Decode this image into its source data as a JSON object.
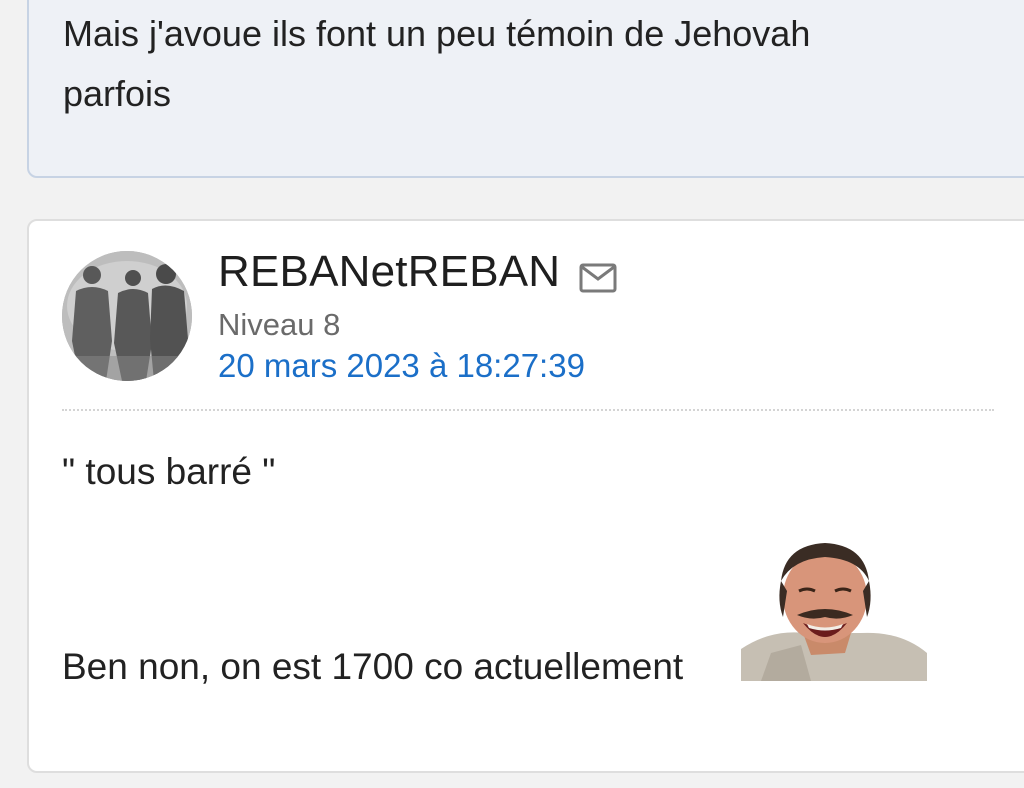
{
  "previous_post": {
    "text_line1": "Mais j'avoue ils font un peu témoin de Jehovah",
    "text_line2": "parfois"
  },
  "post": {
    "author": "REBANetREBAN",
    "level": "Niveau 8",
    "date": "20 mars 2023 à 18:27:39",
    "quote": "\" tous barré \"",
    "body": "Ben non, on est 1700 co actuellement"
  },
  "icons": {
    "message": "mail-icon",
    "avatar": "avatar-silhouettes",
    "sticker": "risitas-sticker"
  },
  "colors": {
    "link_blue": "#1b6fc8",
    "prev_post_bg": "#eef1f6",
    "page_bg": "#f2f2f2"
  }
}
